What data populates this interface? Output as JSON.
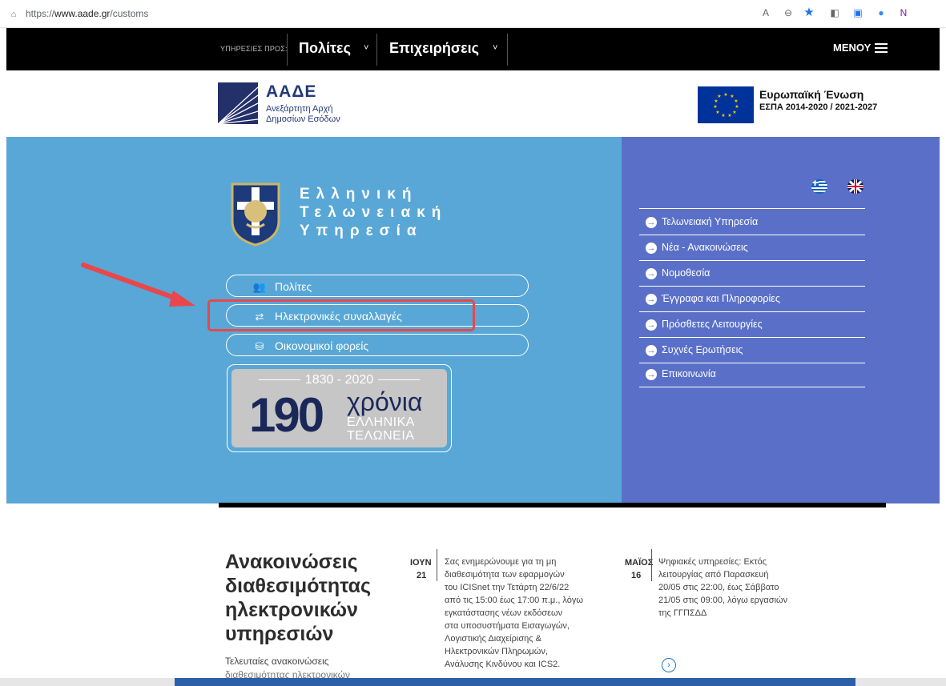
{
  "browser": {
    "url_prefix": "https://",
    "url_host": "www.aade.gr",
    "url_path": "/customs",
    "icons": [
      "lock-icon",
      "read-aloud-icon",
      "zoom-icon",
      "favorite-star-icon",
      "extension-icon",
      "extension-icon-2",
      "zoom-app-icon",
      "onenote-icon"
    ]
  },
  "nav": {
    "prefix": "ΥΠΗΡΕΣΙΕΣ ΠΡΟΣ:",
    "citizens": "Πολίτες",
    "business": "Επιχειρήσεις",
    "caret": "˅",
    "menu": "ΜΕΝΟΥ"
  },
  "header": {
    "aade_title": "ΑΑΔΕ",
    "aade_sub1": "Ανεξάρτητη Αρχή",
    "aade_sub2": "Δημοσίων Εσόδων",
    "eu_title": "Ευρωπαϊκή Ένωση",
    "eu_sub": "ΕΣΠΑ 2014-2020 / 2021-2027"
  },
  "hero": {
    "service_title": [
      "Ελληνική",
      "Τελωνειακή",
      "Υπηρεσία"
    ],
    "pills": [
      {
        "label": "Πολίτες",
        "icon": "users-icon"
      },
      {
        "label": "Ηλεκτρονικές συναλλαγές",
        "icon": "exchange-arrows-icon"
      },
      {
        "label": "Οικονομικοί φορείς",
        "icon": "coins-icon"
      }
    ],
    "anniversary": {
      "years": "1830 - 2020",
      "number": "190",
      "word": "χρόνια",
      "line1": "ΕΛΛΗΝΙΚΑ",
      "line2": "ΤΕΛΩΝΕΙΑ"
    }
  },
  "side_menu": {
    "items": [
      "Τελωνειακή Υπηρεσία",
      "Νέα - Ανακοινώσεις",
      "Νομοθεσία",
      "Έγγραφα και Πληροφορίες",
      "Πρόσθετες Λειτουργίες",
      "Συχνές Ερωτήσεις",
      "Επικοινωνία"
    ]
  },
  "announcements": {
    "heading": [
      "Ανακοινώσεις",
      "διαθεσιμότητας",
      "ηλεκτρονικών",
      "υπηρεσιών"
    ],
    "subheading": "Τελευταίες ανακοινώσεις",
    "subheading2": "διαθεσιμότητας ηλεκτρονικών",
    "items": [
      {
        "month": "ΙΟΥΝ",
        "day": "21",
        "lines": [
          "Σας ενημερώνουμε για τη μη",
          "διαθεσιμότητα των εφαρμογών",
          "του ICISnet την Τετάρτη 22/6/22",
          "από τις 15:00 έως 17:00 π.μ., λόγω",
          "εγκατάστασης νέων εκδόσεων",
          "στα υποσυστήματα Εισαγωγών,",
          "Λογιστικής Διαχείρισης &",
          "Ηλεκτρονικών Πληρωμών,",
          "Ανάλυσης Κινδύνου και ICS2."
        ]
      },
      {
        "month": "ΜΑΪΟΣ",
        "day": "16",
        "lines": [
          "Ψηφιακές υπηρεσίες: Εκτός",
          "λειτουργίας από Παρασκευή",
          "20/05 στις 22:00, έως Σάββατο",
          "21/05 στις 09:00, λόγω εργασιών",
          "της ΓΓΠΣΔΔ"
        ]
      }
    ],
    "more_icon": "chevron-right-circle-icon"
  },
  "colors": {
    "hero_left": "#58a7d6",
    "hero_right": "#5a70c8",
    "highlight": "#e8474b",
    "brand_dark": "#1a2759"
  }
}
